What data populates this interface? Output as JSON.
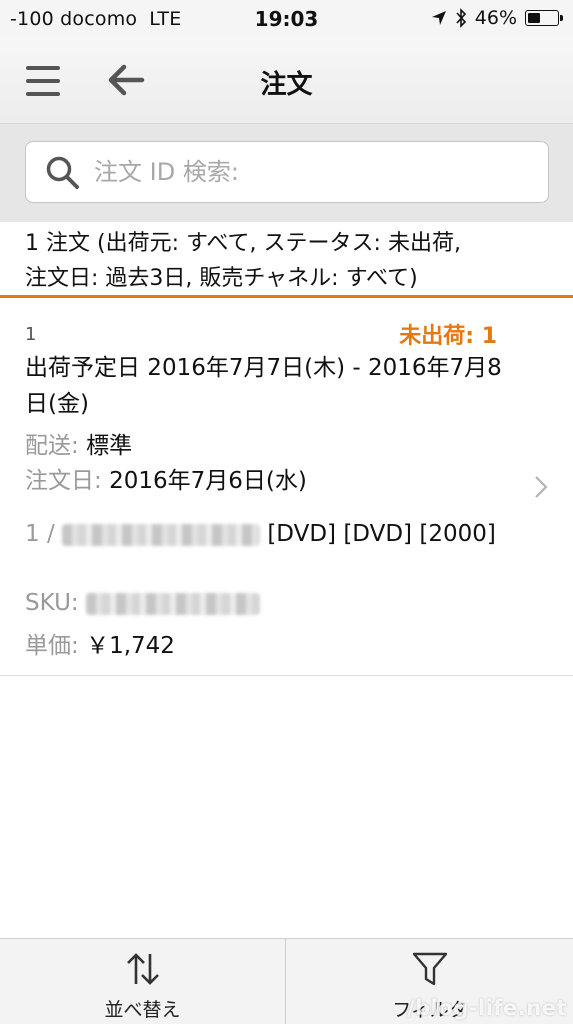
{
  "status_bar": {
    "carrier": "-100 docomo",
    "network": "LTE",
    "time": "19:03",
    "battery": "46%",
    "battery_level": 0.46,
    "icons": [
      "location-arrow-icon",
      "bluetooth-icon",
      "battery-icon"
    ]
  },
  "nav": {
    "title": "注文",
    "icons": [
      "menu-icon",
      "back-arrow-icon"
    ]
  },
  "search": {
    "value": "",
    "placeholder": "注文 ID 検索:"
  },
  "filter_summary": {
    "line1": "1 注文 (出荷元: すべて, ステータス: 未出荷,",
    "line2": "注文日: 過去3日, 販売チャネル: すべて)"
  },
  "order": {
    "index": "1",
    "status": "未出荷: 1",
    "ship_date": "出荷予定日 2016年7月7日(木) - 2016年7月8日(金)",
    "shipping_label": "配送:",
    "shipping_value": "標準",
    "order_date_label": "注文日:",
    "order_date_value": "2016年7月6日(水)",
    "item": {
      "qty": "1 /",
      "title_suffix": "[DVD] [DVD] [2000]",
      "sku_label": "SKU:",
      "price_label": "単価:",
      "price_value": "￥1,742"
    }
  },
  "tabs": [
    {
      "label": "並べ替え",
      "icon": "sort-arrows-icon"
    },
    {
      "label": "フィルタ",
      "icon": "filter-funnel-icon"
    }
  ],
  "watermark": "/blog-life.net",
  "colors": {
    "accent": "#e47911",
    "label_gray": "#9a9a9a"
  }
}
